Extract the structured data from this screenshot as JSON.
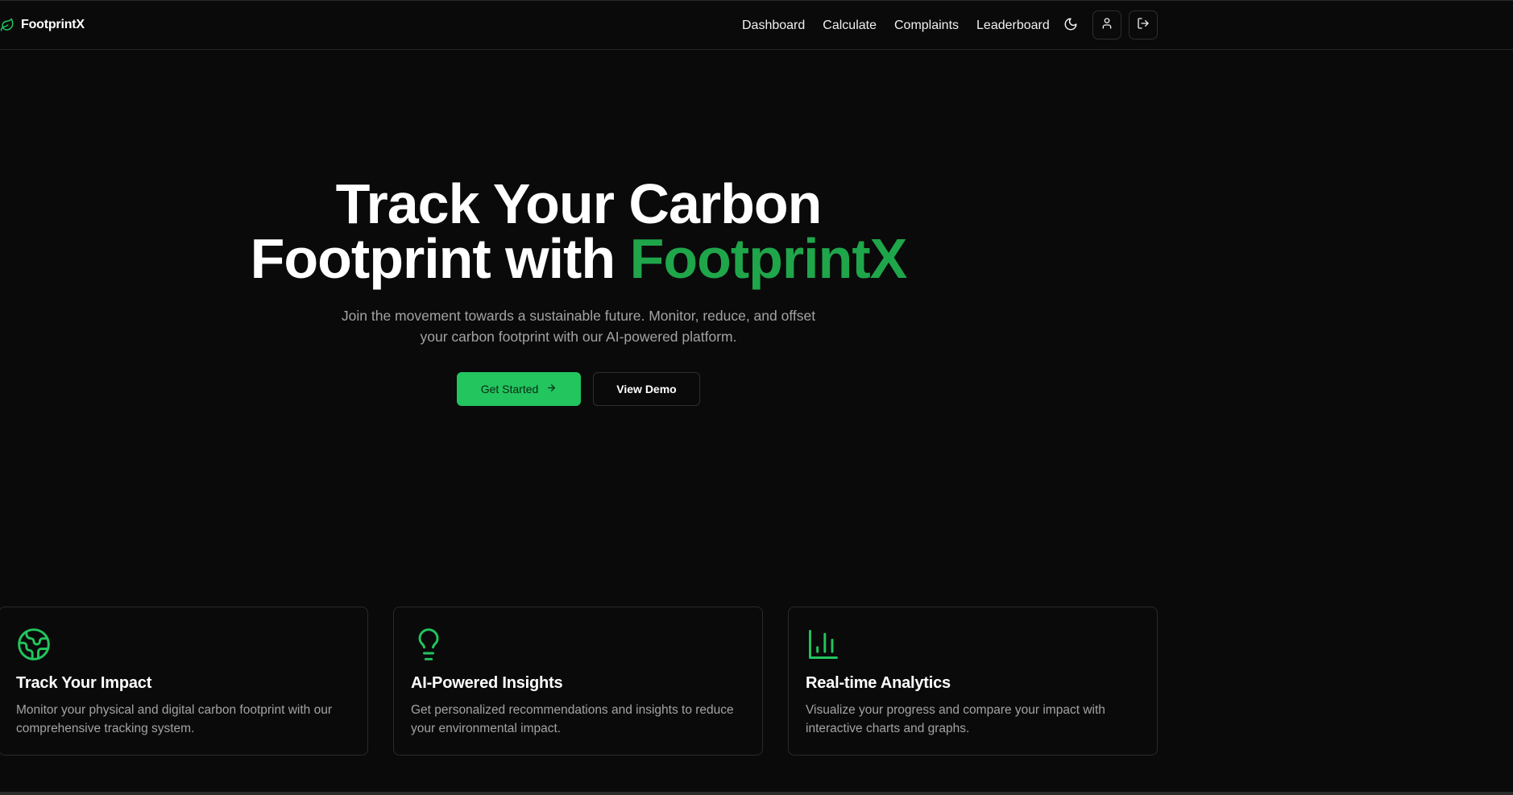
{
  "brand": {
    "name": "FootprintX",
    "accent_color": "#22c55e"
  },
  "nav": {
    "links": [
      "Dashboard",
      "Calculate",
      "Complaints",
      "Leaderboard"
    ],
    "theme_icon": "moon-icon",
    "profile_icon": "user-icon",
    "logout_icon": "log-out-icon"
  },
  "hero": {
    "title_line1": "Track Your Carbon",
    "title_line2_prefix": "Footprint with ",
    "title_line2_accent": "FootprintX",
    "subtitle_line1": "Join the movement towards a sustainable future. Monitor, reduce, and offset",
    "subtitle_line2": "your carbon footprint with our AI-powered platform.",
    "primary_button": "Get Started",
    "primary_button_icon": "arrow-right-icon",
    "secondary_button": "View Demo"
  },
  "features": [
    {
      "icon": "globe-icon",
      "title": "Track Your Impact",
      "description": "Monitor your physical and digital carbon footprint with our comprehensive tracking system."
    },
    {
      "icon": "lightbulb-icon",
      "title": "AI-Powered Insights",
      "description": "Get personalized recommendations and insights to reduce your environmental impact."
    },
    {
      "icon": "bar-chart-icon",
      "title": "Real-time Analytics",
      "description": "Visualize your progress and compare your impact with interactive charts and graphs."
    }
  ]
}
